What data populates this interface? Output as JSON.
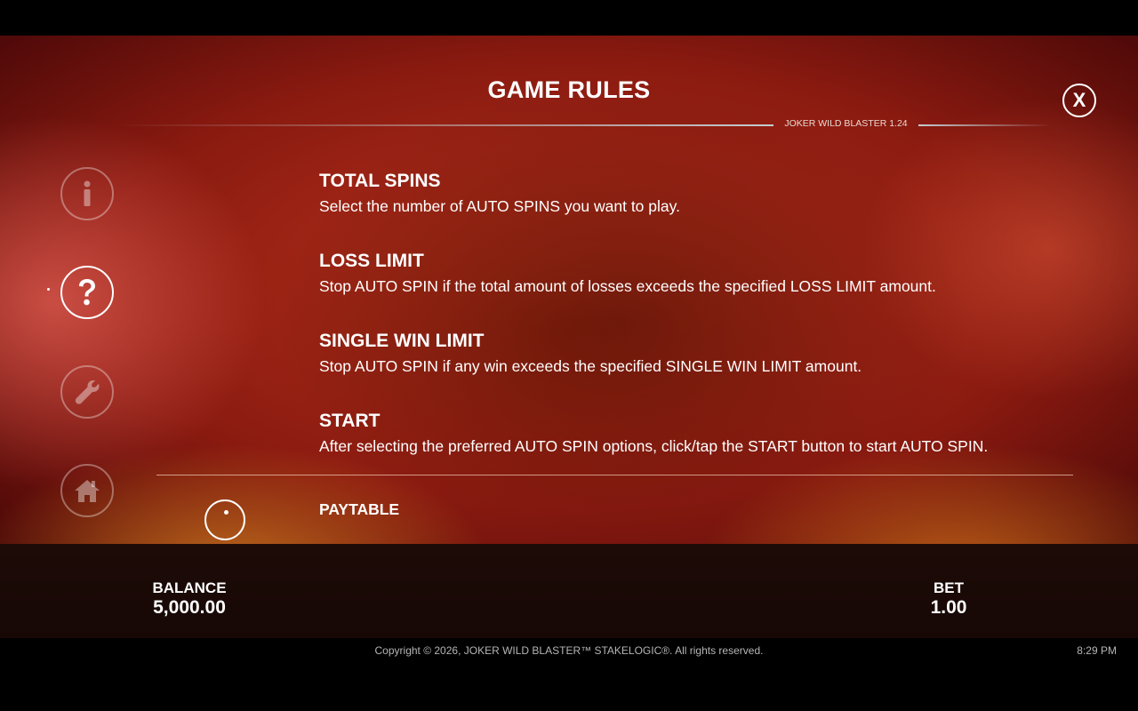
{
  "header": {
    "title": "GAME RULES",
    "close_label": "X",
    "version": "JOKER WILD BLASTER 1.24"
  },
  "nav": [
    {
      "icon": "info-icon",
      "active": false
    },
    {
      "icon": "question-icon",
      "active": true
    },
    {
      "icon": "wrench-icon",
      "active": false
    },
    {
      "icon": "home-icon",
      "active": false
    }
  ],
  "sections": [
    {
      "title": "TOTAL SPINS",
      "text": "Select the number of AUTO SPINS you want to play."
    },
    {
      "title": "LOSS LIMIT",
      "text": "Stop AUTO SPIN if the total amount of losses exceeds the specified LOSS LIMIT amount."
    },
    {
      "title": "SINGLE WIN LIMIT",
      "text": "Stop AUTO SPIN if any win exceeds the specified SINGLE WIN LIMIT amount."
    },
    {
      "title": "START",
      "text": "After selecting the preferred AUTO SPIN options, click/tap the START button to start AUTO SPIN."
    }
  ],
  "next_section": {
    "title": "PAYTABLE"
  },
  "status": {
    "balance_label": "BALANCE",
    "balance_value": "5,000.00",
    "bet_label": "BET",
    "bet_value": "1.00"
  },
  "footer": {
    "copyright": "Copyright © 2026, JOKER WILD BLASTER™ STAKELOGIC®. All rights reserved.",
    "time": "8:29 PM"
  }
}
